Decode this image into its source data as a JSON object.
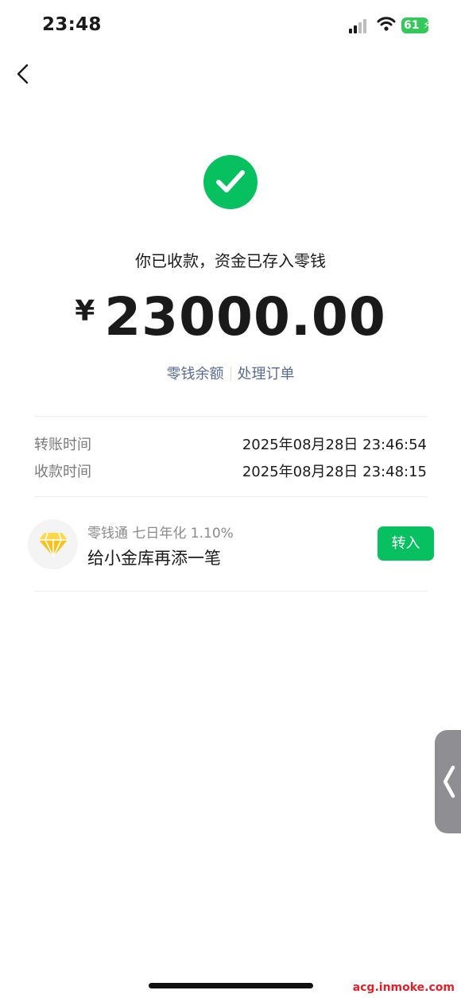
{
  "status_bar": {
    "time": "23:48",
    "battery": "61"
  },
  "result": {
    "headline": "你已收款，资金已存入零钱",
    "currency": "¥",
    "amount": "23000.00"
  },
  "links": {
    "balance": "零钱余额",
    "process_order": "处理订单"
  },
  "details": [
    {
      "label": "转账时间",
      "value": "2025年08月28日 23:46:54"
    },
    {
      "label": "收款时间",
      "value": "2025年08月28日 23:48:15"
    }
  ],
  "promo": {
    "subtitle": "零钱通 七日年化 1.10%",
    "title": "给小金库再添一笔",
    "button": "转入"
  },
  "watermark": "acg.inmoke.com",
  "colors": {
    "success_green": "#07c160",
    "link_blue": "#576b95",
    "battery_green": "#34c759",
    "diamond_yellow": "#f7c21a"
  },
  "icons": {
    "back": "chevron-left-icon",
    "success": "check-circle-icon",
    "promo": "diamond-icon",
    "side_handle": "chevron-left-icon"
  }
}
